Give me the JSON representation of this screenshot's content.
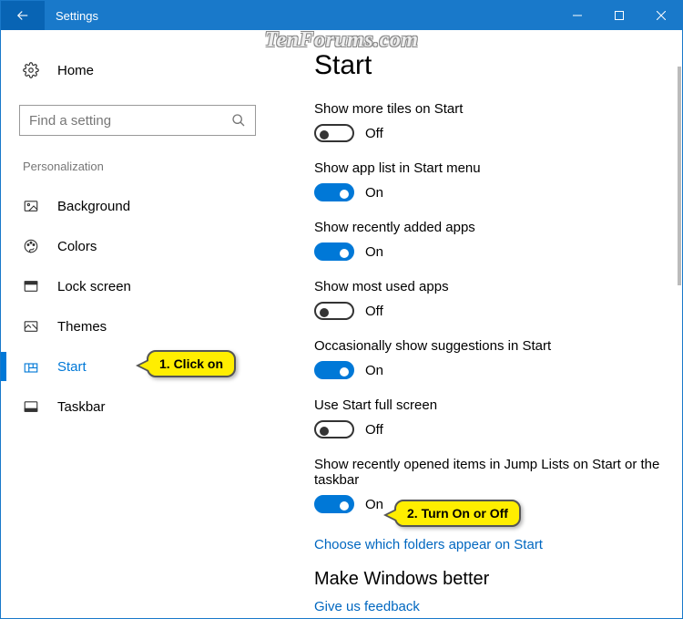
{
  "window": {
    "title": "Settings"
  },
  "watermark": "TenForums.com",
  "sidebar": {
    "home": "Home",
    "search_placeholder": "Find a setting",
    "section": "Personalization",
    "items": [
      {
        "label": "Background"
      },
      {
        "label": "Colors"
      },
      {
        "label": "Lock screen"
      },
      {
        "label": "Themes"
      },
      {
        "label": "Start"
      },
      {
        "label": "Taskbar"
      }
    ]
  },
  "main": {
    "heading": "Start",
    "settings": [
      {
        "label": "Show more tiles on Start",
        "on": false,
        "state": "Off"
      },
      {
        "label": "Show app list in Start menu",
        "on": true,
        "state": "On"
      },
      {
        "label": "Show recently added apps",
        "on": true,
        "state": "On"
      },
      {
        "label": "Show most used apps",
        "on": false,
        "state": "Off"
      },
      {
        "label": "Occasionally show suggestions in Start",
        "on": true,
        "state": "On"
      },
      {
        "label": "Use Start full screen",
        "on": false,
        "state": "Off"
      },
      {
        "label": "Show recently opened items in Jump Lists on Start or the taskbar",
        "on": true,
        "state": "On"
      }
    ],
    "link_choose_folders": "Choose which folders appear on Start",
    "subhead": "Make Windows better",
    "feedback_link": "Give us feedback"
  },
  "callouts": {
    "c1": "1. Click on",
    "c2": "2. Turn On or Off"
  }
}
